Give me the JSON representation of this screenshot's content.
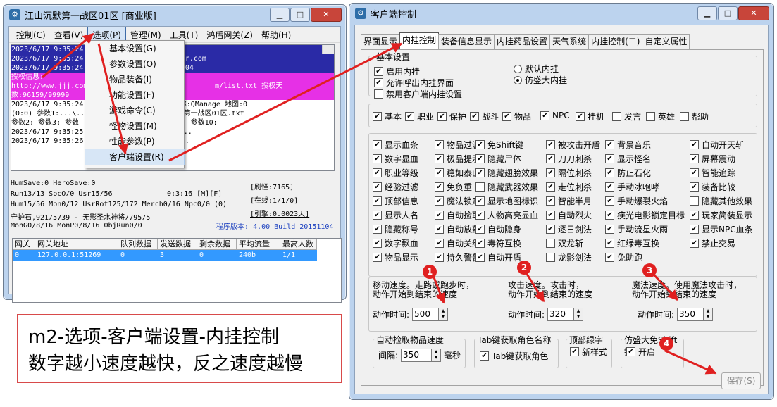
{
  "left_window": {
    "title": "江山沉默第一战区01区 [商业版]",
    "menubar": [
      "控制(C)",
      "查看(V)",
      "选项(P)",
      "管理(M)",
      "工具(T)",
      "鸿盾网关(Z)",
      "帮助(H)"
    ],
    "log_lines": [
      "2023/6/17 9:35:24                                  ",
      "2023/6/17 9:35:24                      mir.com",
      "2023/6/17 9:35:24                        04",
      "授权信息:",
      "http://www.jjj.com                              m/list.txt 授权天",
      "数:96159/99999",
      "2023/6/17 9:35:24             FILE NPC名称:QManage 地图:0",
      "(0:0) 参数1:...\\...\\            励\\江山沉默第一战区01区.txt",
      "参数2: 参数3: 参数                 8: 参数9: 参数10:",
      "2023/6/17 9:35:25                连接成功...",
      "2023/6/17 9:35:26                )已打开..."
    ],
    "stats": {
      "line1": "HumSave:0 HeroSave:0",
      "line2": "Run13/13 SocO/0 Usr15/56",
      "time": "0:3:16 [M][F]",
      "line3": "Hum15/56 Mon0/12 UsrRot125/172 Merch0/16 Npc0/0 (0)",
      "line4": "守护石,921/5739 - 无影圣水神将/795/5",
      "line5": "MonG0/8/16 MonP0/8/16 ObjRun0/0",
      "refresh": "[刷怪:7165]",
      "online": "[在线:1/1/0]",
      "engine": "[引擎:0.0023天]",
      "version": "程序版本: 4.00 Build 20151104"
    },
    "table": {
      "headers": [
        "网关",
        "网关地址",
        "队列数据",
        "发送数据",
        "剩余数据",
        "平均流量",
        "最高人数"
      ],
      "rows": [
        [
          "0",
          "127.0.0.1:51269",
          "0",
          "3",
          "0",
          "240b",
          "1/1"
        ]
      ]
    },
    "dropdown_menu": [
      "基本设置(G)",
      "参数设置(O)",
      "物品装备(I)",
      "功能设置(F)",
      "游戏命令(C)",
      "怪物设置(M)",
      "性能参数(P)",
      "客户端设置(R)"
    ]
  },
  "right_window": {
    "title": "客户端控制",
    "tabs": [
      "界面显示",
      "内挂控制",
      "装备信息显示",
      "内挂药品设置",
      "天气系统",
      "内挂控制(二)",
      "自定义属性"
    ],
    "basic_group_title": "基本设置",
    "basic_checks": [
      {
        "label": "启用内挂",
        "checked": true
      },
      {
        "label": "允许呼出内挂界面",
        "checked": true
      },
      {
        "label": "禁用客户端内挂设置",
        "checked": false
      }
    ],
    "radios": [
      {
        "label": "默认内挂",
        "checked": false
      },
      {
        "label": "仿盛大内挂",
        "checked": true
      }
    ],
    "category_checks": [
      {
        "label": "基本",
        "checked": true
      },
      {
        "label": "职业",
        "checked": true
      },
      {
        "label": "保护",
        "checked": true
      },
      {
        "label": "战斗",
        "checked": true
      },
      {
        "label": "物品",
        "checked": true
      },
      {
        "label": "NPC",
        "checked": true
      },
      {
        "label": "挂机",
        "checked": true
      },
      {
        "label": "发言",
        "checked": false
      },
      {
        "label": "英雄",
        "checked": false
      },
      {
        "label": "帮助",
        "checked": false
      }
    ],
    "option_columns": [
      [
        {
          "label": "显示血条",
          "checked": true
        },
        {
          "label": "数字显血",
          "checked": true
        },
        {
          "label": "职业等级",
          "checked": true
        },
        {
          "label": "经验过滤",
          "checked": true
        },
        {
          "label": "顶部信息",
          "checked": true
        },
        {
          "label": "显示人名",
          "checked": true
        },
        {
          "label": "隐藏称号",
          "checked": true
        },
        {
          "label": "数字飘血",
          "checked": true
        },
        {
          "label": "物品显示",
          "checked": true
        }
      ],
      [
        {
          "label": "物品过滤",
          "checked": true
        },
        {
          "label": "极品提示",
          "checked": true
        },
        {
          "label": "稳如泰山",
          "checked": true
        },
        {
          "label": "免负重",
          "checked": true
        },
        {
          "label": "魔法锁定",
          "checked": true
        },
        {
          "label": "自动捡取",
          "checked": true
        },
        {
          "label": "自动放药",
          "checked": true
        },
        {
          "label": "自动关组",
          "checked": true
        },
        {
          "label": "持久警告",
          "checked": true
        }
      ],
      [
        {
          "label": "免Shift键",
          "checked": true
        },
        {
          "label": "隐藏尸体",
          "checked": true
        },
        {
          "label": "隐藏翅膀效果",
          "checked": true
        },
        {
          "label": "隐藏武器效果",
          "checked": false
        },
        {
          "label": "显示地图标识",
          "checked": true
        },
        {
          "label": "人物高亮显血",
          "checked": true
        },
        {
          "label": "自动隐身",
          "checked": true
        },
        {
          "label": "毒符互换",
          "checked": true
        },
        {
          "label": "自动开盾",
          "checked": true
        }
      ],
      [
        {
          "label": "被攻击开盾",
          "checked": true
        },
        {
          "label": "刀刀刺杀",
          "checked": true
        },
        {
          "label": "隔位刺杀",
          "checked": true
        },
        {
          "label": "走位刺杀",
          "checked": true
        },
        {
          "label": "智能半月",
          "checked": true
        },
        {
          "label": "自动烈火",
          "checked": true
        },
        {
          "label": "逐日剑法",
          "checked": true
        },
        {
          "label": "双龙斩",
          "checked": false
        },
        {
          "label": "龙影剑法",
          "checked": false
        }
      ],
      [
        {
          "label": "背景音乐",
          "checked": true
        },
        {
          "label": "显示怪名",
          "checked": true
        },
        {
          "label": "防止石化",
          "checked": true
        },
        {
          "label": "手动冰咆哮",
          "checked": true
        },
        {
          "label": "手动爆裂火焰",
          "checked": true
        },
        {
          "label": "疾光电影锁定目标",
          "checked": true
        },
        {
          "label": "手动流星火雨",
          "checked": true
        },
        {
          "label": "红绿毒互换",
          "checked": true
        },
        {
          "label": "免助跑",
          "checked": true
        }
      ],
      [
        {
          "label": "自动开天斩",
          "checked": true
        },
        {
          "label": "屏幕震动",
          "checked": true
        },
        {
          "label": "智能追踪",
          "checked": true
        },
        {
          "label": "装备比较",
          "checked": true
        },
        {
          "label": "隐藏其他效果",
          "checked": false
        },
        {
          "label": "玩家简装显示",
          "checked": true
        },
        {
          "label": "显示NPC血条",
          "checked": true
        },
        {
          "label": "禁止交易",
          "checked": true
        }
      ]
    ],
    "speed": {
      "move_label": "移动速度。走路或跑步时，\n动作开始到结束的速度",
      "attack_label": "攻击速度。攻击时，\n动作开始到结束的速度",
      "magic_label": "魔法速度。使用魔法攻击时，\n动作开始到结束的速度",
      "action_time_label": "动作时间:",
      "move_value": "500",
      "attack_value": "320",
      "magic_value": "350"
    },
    "pickup": {
      "title": "自动捡取物品速度",
      "interval_label": "间隔:",
      "value": "350",
      "unit": "毫秒"
    },
    "tab_key": {
      "title": "Tab键获取角色名称",
      "check_label": "Tab键获取角色",
      "checked": true
    },
    "top_green": {
      "title": "顶部绿字",
      "check_label": "新样式",
      "checked": true
    },
    "fake_shift": {
      "title": "仿盛大免Shift键",
      "check_label": "开启",
      "checked": true
    },
    "save_button": "保存(S)"
  },
  "badges": [
    "1",
    "2",
    "3",
    "4"
  ],
  "caption": {
    "line1": "m2-选项-客户端设置-内挂控制",
    "line2": "数字越小速度越快，反之速度越慢"
  },
  "colors": {
    "annotation": "#e02020",
    "selection": "#3399ff"
  }
}
